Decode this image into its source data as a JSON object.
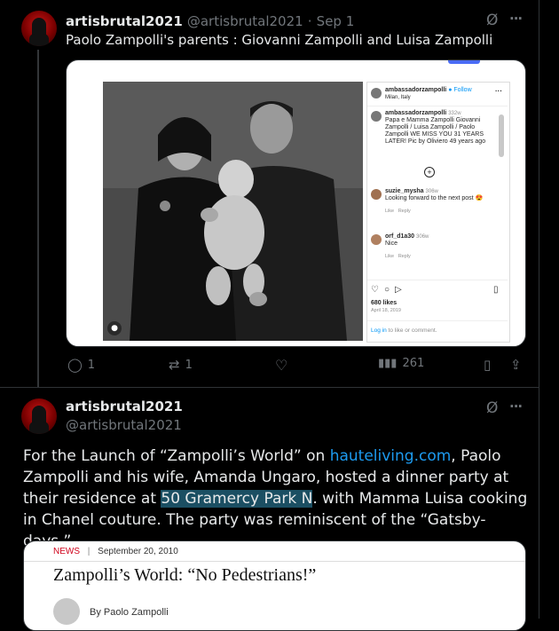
{
  "tweet1": {
    "display_name": "artisbrutal2021",
    "handle": "@artisbrutal2021",
    "separator": "·",
    "date": "Sep 1",
    "text": "Paolo Zampolli's parents : Giovanni Zampolli and Luisa Zampolli",
    "more_label": "···",
    "grok_label": "Ø",
    "replies": "1",
    "reposts": "1",
    "views": "261",
    "embedded_post": {
      "account": "ambassadorzampolli",
      "follow_label": "Follow",
      "location": "Milan, Italy",
      "caption_time": "332w",
      "caption": "Papa e Mamma  Zampolli Giovanni Zampolli / Luisa Zampolli / Paolo Zampolli WE MISS YOU 31 YEARS LATER!  Pic by Oliviero 49 years ago",
      "comments": [
        {
          "user": "suzie_mysha",
          "time": "306w",
          "text": "Looking forward to the next post 😍",
          "like": "Like",
          "reply": "Reply"
        },
        {
          "user": "orf_d1a30",
          "time": "306w",
          "text": "Nice",
          "like": "Like",
          "reply": "Reply"
        }
      ],
      "likes": "680 likes",
      "date": "April 18, 2019",
      "login_link": "Log in",
      "login_text": " to like or comment."
    }
  },
  "tweet2": {
    "display_name": "artisbrutal2021",
    "handle": "@artisbrutal2021",
    "more_label": "···",
    "grok_label": "Ø",
    "text_part1": "For the Launch of “Zampolli’s World” on ",
    "link_text": "hauteliving.com",
    "text_part2": ", Paolo Zampolli and his wife, Amanda Ungaro, hosted a dinner party at their residence at ",
    "highlight_text": "50 Gramercy Park N",
    "text_part3": ". with Mamma Luisa cooking  in Chanel couture. The party was reminiscent of the “Gatsby-days,”",
    "article": {
      "category": "NEWS",
      "separator": "|",
      "date": "September 20, 2010",
      "title": "Zampolli’s World: “No Pedestrians!”",
      "byline": "By  Paolo Zampolli"
    }
  },
  "colors": {
    "background": "#000000",
    "text_primary": "#e7e9ea",
    "text_secondary": "#71767b",
    "link": "#1d9bf0",
    "article_category": "#d0021b"
  }
}
